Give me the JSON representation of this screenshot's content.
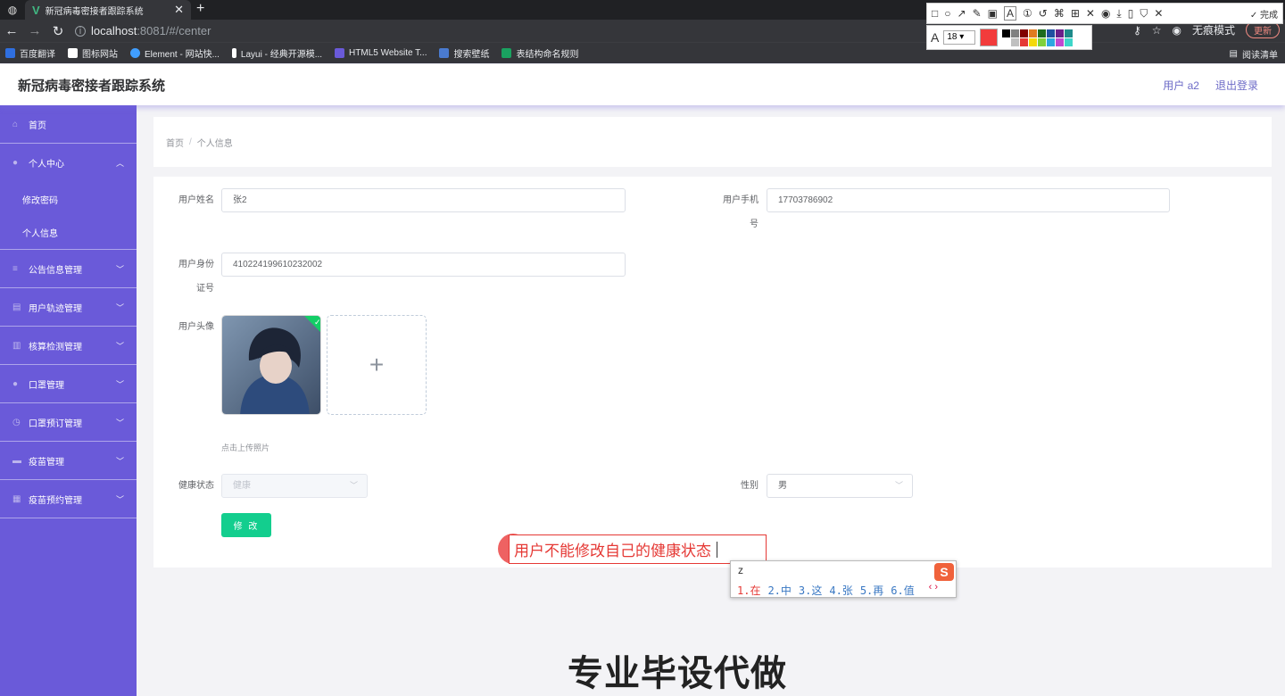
{
  "browser": {
    "tab_title": "新冠病毒密接者跟踪系统",
    "new_tab": "+",
    "close": "✕",
    "url_host": "localhost",
    "url_rest": ":8081/#/center",
    "incognito_label": "无痕模式",
    "update_label": "更新",
    "reading_list": "阅读清单",
    "bookmarks": [
      {
        "label": "百度翻译",
        "color": "#2f6fe0"
      },
      {
        "label": "图标网站",
        "color": "#ffffff"
      },
      {
        "label": "Element - 网站快...",
        "color": "#409eff"
      },
      {
        "label": "Layui - 经典开源模...",
        "color": "#ffffff"
      },
      {
        "label": "HTML5 Website T...",
        "color": "#6a5ad9"
      },
      {
        "label": "搜索壁纸",
        "color": "#4a7bd0"
      },
      {
        "label": "表结构命名规则",
        "color": "#1aa260"
      }
    ]
  },
  "snip_tool": {
    "font_letter": "A",
    "font_size": "18",
    "done_label": "完成",
    "current_color": "#f23b3b",
    "palette": [
      "#000000",
      "#808080",
      "#800000",
      "#e07b20",
      "#1e6b1e",
      "#1f4fa0",
      "#6a1f8a",
      "#1d8a8a",
      "#ffffff",
      "#c0c0c0",
      "#e53935",
      "#f5d90a",
      "#7fd13b",
      "#2ea6e0",
      "#c04ad0",
      "#3dd6c9"
    ]
  },
  "app": {
    "title": "新冠病毒密接者跟踪系统",
    "user_label": "用户 a2",
    "logout_label": "退出登录"
  },
  "sidebar": {
    "items": [
      {
        "label": "首页",
        "icon": "home-icon",
        "glyph": "⌂"
      },
      {
        "label": "个人中心",
        "icon": "user-icon",
        "glyph": "●",
        "expanded": true
      },
      {
        "label": "修改密码",
        "sub": true
      },
      {
        "label": "个人信息",
        "sub": true
      },
      {
        "label": "公告信息管理",
        "icon": "list-icon",
        "glyph": "≡"
      },
      {
        "label": "用户轨迹管理",
        "icon": "document-icon",
        "glyph": "▤"
      },
      {
        "label": "核算检测管理",
        "icon": "chart-icon",
        "glyph": "▥"
      },
      {
        "label": "口罩管理",
        "icon": "user-icon",
        "glyph": "●"
      },
      {
        "label": "口罩预订管理",
        "icon": "clock-icon",
        "glyph": "◷"
      },
      {
        "label": "疫苗管理",
        "icon": "folder-icon",
        "glyph": "▬"
      },
      {
        "label": "疫苗预约管理",
        "icon": "grid-icon",
        "glyph": "▦"
      }
    ]
  },
  "breadcrumb": {
    "home": "首页",
    "separator": "/",
    "current": "个人信息"
  },
  "form": {
    "name_label": "用户姓名",
    "name_value": "张2",
    "phone_label": "用户手机号",
    "phone_value": "17703786902",
    "idcard_label": "用户身份证号",
    "idcard_value": "410224199610232002",
    "avatar_label": "用户头像",
    "upload_tip": "点击上传照片",
    "upload_plus": "+",
    "health_label": "健康状态",
    "health_value": "健康",
    "gender_label": "性别",
    "gender_value": "男",
    "submit_label": "修 改"
  },
  "annotation": {
    "text": "用户不能修改自己的健康状态"
  },
  "ime": {
    "input": "z",
    "logo": "S",
    "candidates": [
      "1.在",
      "2.中",
      "3.这",
      "4.张",
      "5.再",
      "6.值"
    ],
    "nav": "‹ ›"
  },
  "watermark": "专业毕设代做"
}
